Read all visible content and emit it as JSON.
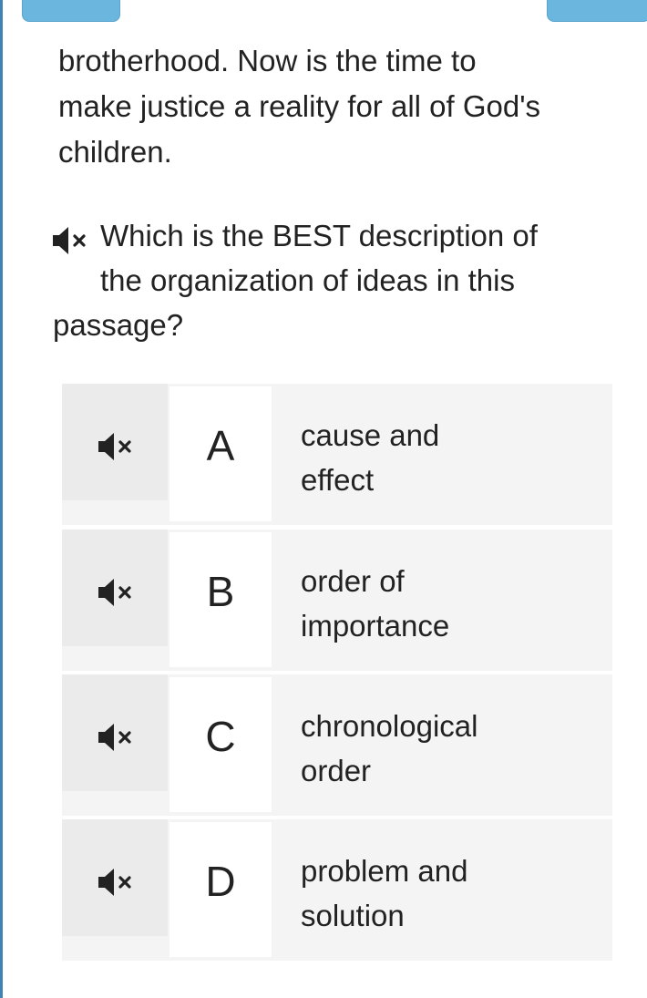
{
  "passage": {
    "lines": [
      "brotherhood. Now is the time to",
      "make justice a reality for all of God's",
      "children."
    ]
  },
  "question": {
    "lines": [
      "Which is the BEST description of",
      "the organization of ideas in this",
      "passage?"
    ],
    "icon": "speaker-muted-icon"
  },
  "choices": [
    {
      "letter": "A",
      "lines": [
        "cause and",
        "effect"
      ],
      "icon": "speaker-muted-icon"
    },
    {
      "letter": "B",
      "lines": [
        "order of",
        "importance"
      ],
      "icon": "speaker-muted-icon"
    },
    {
      "letter": "C",
      "lines": [
        "chronological",
        "order"
      ],
      "icon": "speaker-muted-icon"
    },
    {
      "letter": "D",
      "lines": [
        "problem and",
        "solution"
      ],
      "icon": "speaker-muted-icon"
    }
  ],
  "colors": {
    "top_button": "#6bb6de",
    "edge": "#3f82b3",
    "choice_bg": "#f4f4f4",
    "audio_cell_bg": "#ebebeb"
  }
}
